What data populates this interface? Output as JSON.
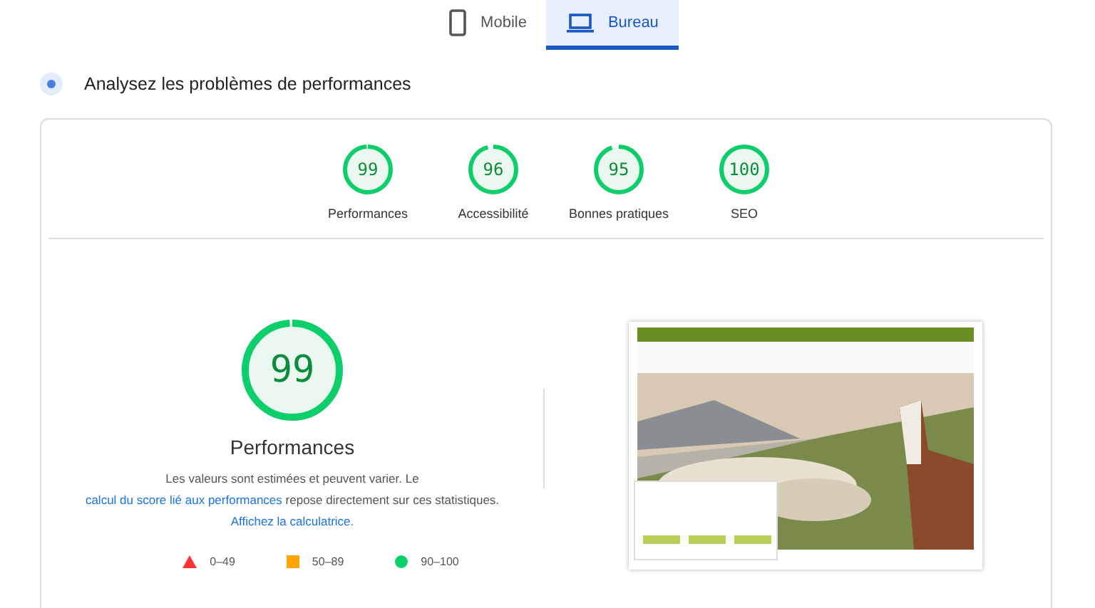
{
  "tabs": [
    {
      "label": "Mobile",
      "kind": "phone",
      "selected": false
    },
    {
      "label": "Bureau",
      "kind": "laptop",
      "selected": true
    }
  ],
  "heading": "Analysez les problèmes de performances",
  "gauges": [
    {
      "score": "99",
      "label": "Performances",
      "level": 0.99
    },
    {
      "score": "96",
      "label": "Accessibilité",
      "level": 0.96
    },
    {
      "score": "95",
      "label": "Bonnes pratiques",
      "level": 0.95
    },
    {
      "score": "100",
      "label": "SEO",
      "level": 1
    }
  ],
  "detail": {
    "score": "99",
    "level": 0.99,
    "title": "Performances",
    "text_before": "Les valeurs sont estimées et peuvent varier. Le ",
    "link1": "calcul du score lié aux performances",
    "text_middle": " repose directement sur ces statistiques. ",
    "link2": "Affichez la calculatrice."
  },
  "legend": [
    {
      "kind": "triangle",
      "label": "0–49",
      "color": "#ff3333"
    },
    {
      "kind": "square",
      "label": "50–89",
      "color": "#ffa400"
    },
    {
      "kind": "circle",
      "label": "90–100",
      "color": "#0cce6b"
    }
  ]
}
